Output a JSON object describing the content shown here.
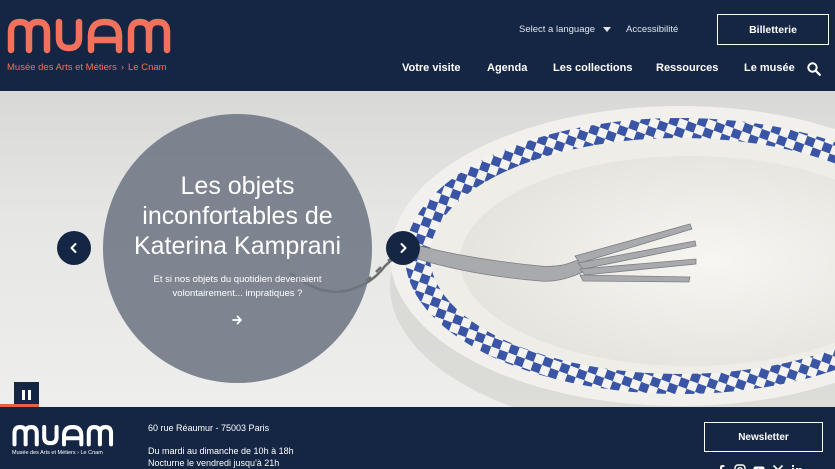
{
  "header": {
    "logo_text": "muam",
    "logo_subtitle_left": "Musée des Arts et Métiers",
    "logo_subtitle_sep": "›",
    "logo_subtitle_right": "Le Cnam",
    "language_label": "Select a language",
    "accessibility_label": "Accessibilité",
    "ticket_label": "Billetterie",
    "nav": [
      "Votre visite",
      "Agenda",
      "Les collections",
      "Ressources",
      "Le musée"
    ]
  },
  "hero": {
    "title": "Les objets inconfortables de Katerina Kamprani",
    "description": "Et si nos objets du quotidien devenaient volontairement... impratiques ?"
  },
  "footer": {
    "logo_text": "muam",
    "logo_subtitle": "Musée des Arts et Métiers › Le Cnam",
    "address": "60 rue Réaumur - 75003 Paris",
    "hours": "Du mardi au dimanche de 10h à 18h",
    "nocturne": "Nocturne le vendredi jusqu'à 21h",
    "newsletter_label": "Newsletter"
  },
  "colors": {
    "navy": "#142644",
    "coral": "#f0725c",
    "plate_blue": "#3a55a6"
  }
}
